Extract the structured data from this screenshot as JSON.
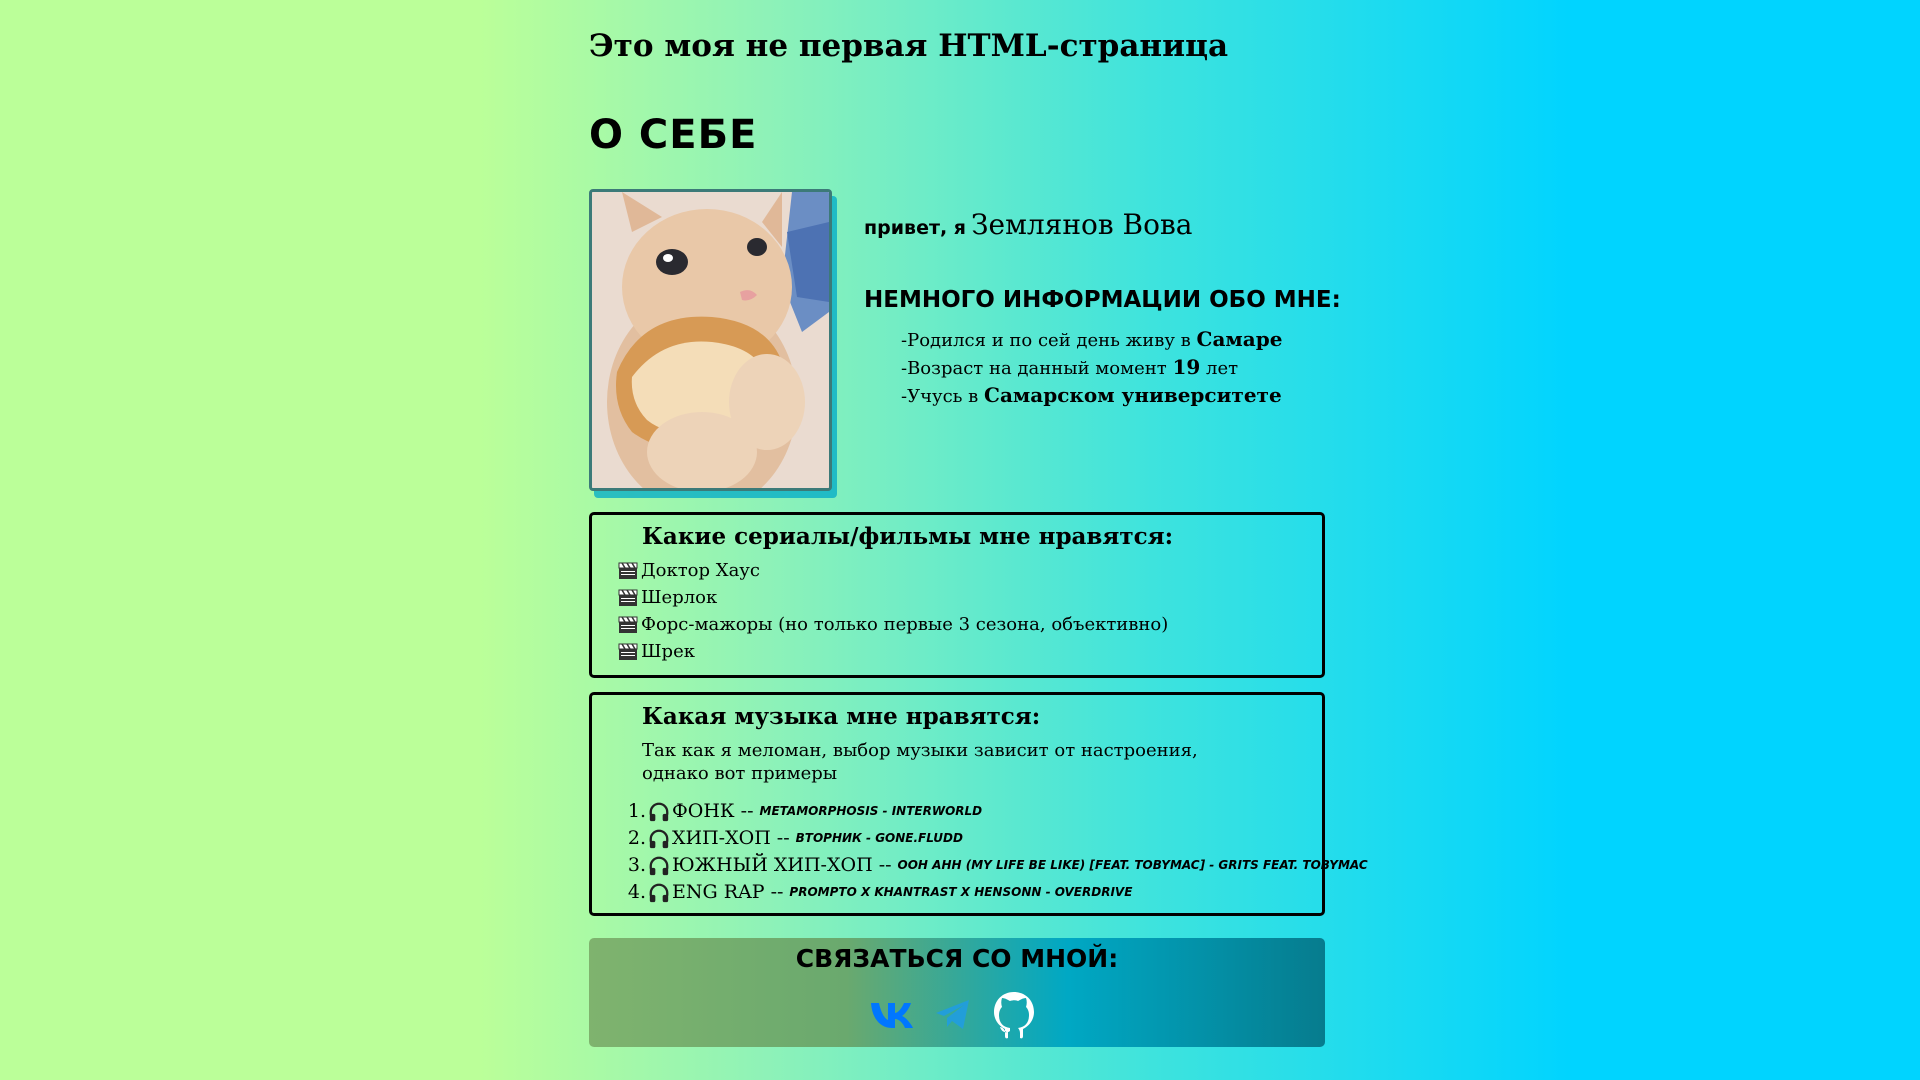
{
  "page": {
    "title": "Это моя не первая HTML-страница"
  },
  "about": {
    "heading": "О СЕБЕ",
    "greeting": "привет, я",
    "name": "Землянов Вова",
    "info_heading": "НЕМНОГО ИНФОРМАЦИИ ОБО МНЕ:",
    "facts": [
      {
        "text": "-Родился и по сей день живу в ",
        "bold": "Самаре",
        "after": ""
      },
      {
        "text": "-Возраст на данный момент ",
        "bold": "19",
        "after": " лет"
      },
      {
        "text": "-Учусь в ",
        "bold": "Самарском университете",
        "after": ""
      }
    ]
  },
  "movies": {
    "heading": "Какие сериалы/фильмы мне нравятся:",
    "items": [
      "Доктор Хаус",
      "Шерлок",
      "Форс-мажоры (но только первые 3 сезона, объективно)",
      "Шрек"
    ]
  },
  "music": {
    "heading": "Какая музыка мне нравятся:",
    "description": "Так как я меломан, выбор музыки зависит от настроения, однако вот примеры",
    "items": [
      {
        "num": "1.",
        "genre": "ФОНК --",
        "track": "METAMORPHOSIS - INTERWORLD"
      },
      {
        "num": "2.",
        "genre": "ХИП-ХОП --",
        "track": "ВТОРНИК - GONE.FLUDD"
      },
      {
        "num": "3.",
        "genre": "ЮЖНЫЙ ХИП-ХОП --",
        "track": "OOH AHH (MY LIFE BE LIKE) [FEAT. TOBYMAC] - GRITS FEAT. TOBYMAC"
      },
      {
        "num": "4.",
        "genre": "ENG RAP --",
        "track": "PROMPTO X KHANTRAST X HENSONN - OVERDRIVE"
      }
    ]
  },
  "contact": {
    "heading": "СВЯЗАТЬСЯ СО МНОЙ:",
    "icons": [
      "vk-icon",
      "telegram-icon",
      "github-icon"
    ],
    "colors": {
      "vk": "#0077ff",
      "telegram": "#229ed9",
      "github": "#ffffff"
    }
  },
  "colors": {
    "bg_left": "#bbff99",
    "bg_right": "#00d4ff"
  }
}
